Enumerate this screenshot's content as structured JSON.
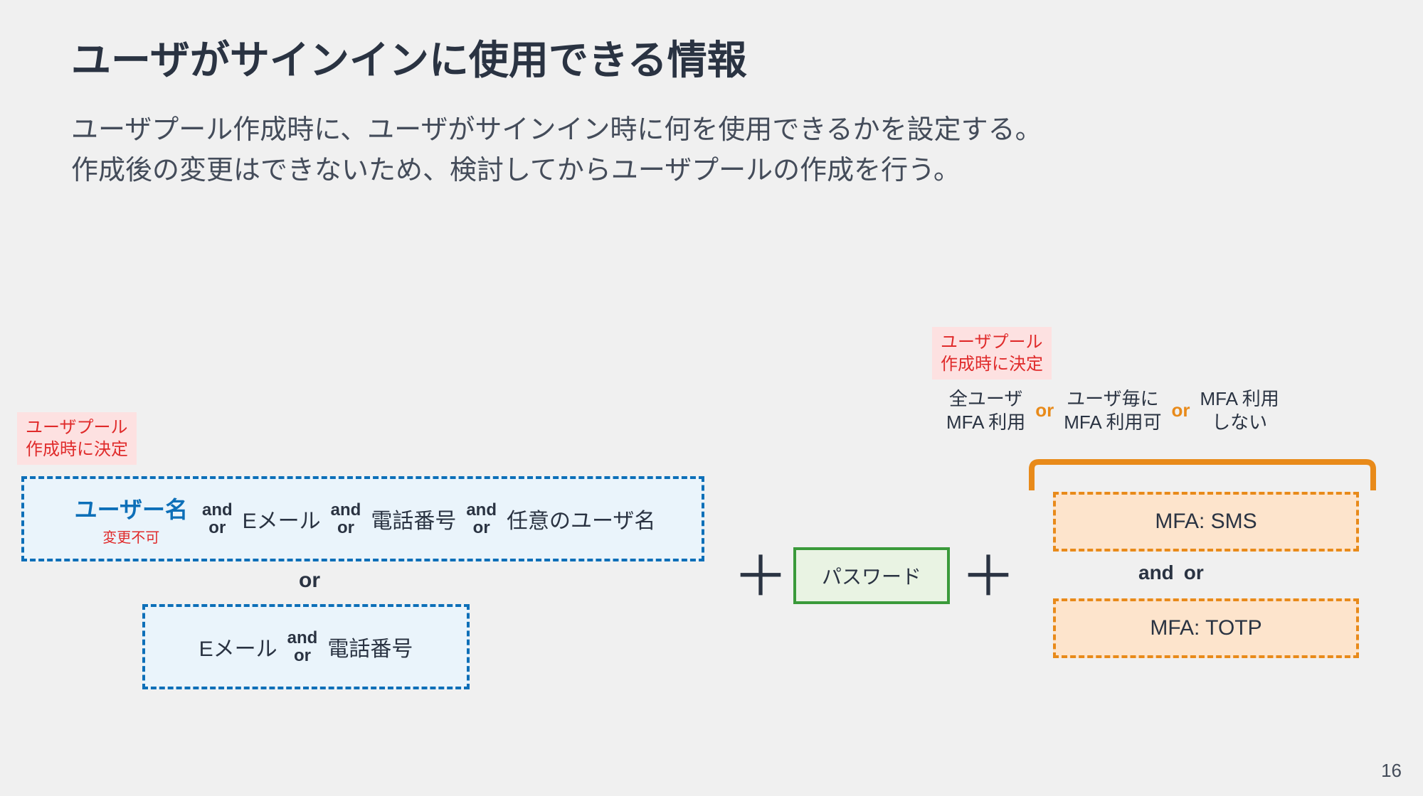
{
  "title": "ユーザがサインインに使用できる情報",
  "description": "ユーザプール作成時に、ユーザがサインイン時に何を使用できるかを設定する。\n作成後の変更はできないため、検討してからユーザプールの作成を行う。",
  "note": "ユーザプール\n作成時に決定",
  "identifiers": {
    "row1": {
      "username": "ユーザー名",
      "immutable": "変更不可",
      "email": "Eメール",
      "phone": "電話番号",
      "alias": "任意のユーザ名"
    },
    "row2": {
      "email": "Eメール",
      "phone": "電話番号"
    }
  },
  "connectors": {
    "and": "and",
    "or": "or",
    "plus": "＋"
  },
  "password": "パスワード",
  "mfa": {
    "opt_all": "全ユーザ\nMFA 利用",
    "opt_per": "ユーザ毎に\nMFA 利用可",
    "opt_none": "MFA 利用\nしない",
    "sms": "MFA: SMS",
    "totp": "MFA: TOTP"
  },
  "page": "16"
}
